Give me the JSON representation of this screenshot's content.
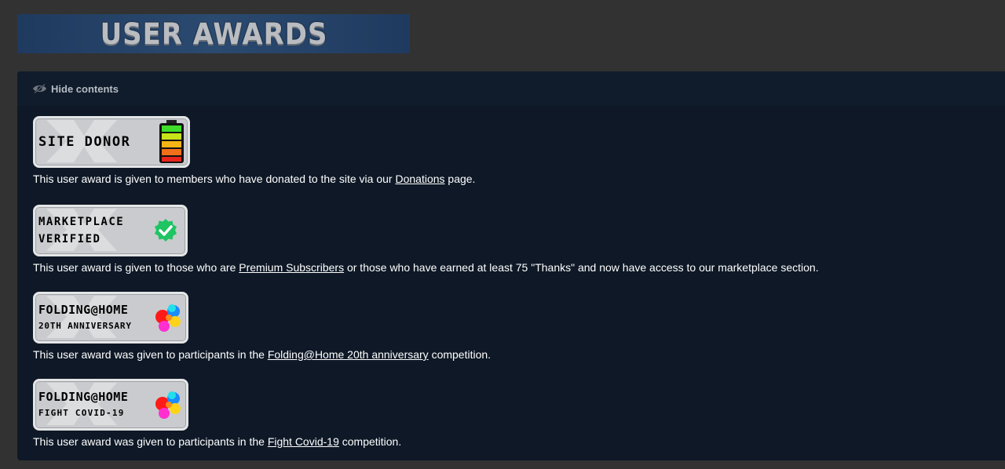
{
  "banner": {
    "title": "USER AWARDS"
  },
  "panel": {
    "toggle_label": "Hide contents"
  },
  "awards": [
    {
      "badge_line1": "SITE DONOR",
      "desc_before": "This user award is given to members who have donated to the site via our ",
      "link": "Donations",
      "desc_after": " page.",
      "icon": "battery-icon"
    },
    {
      "badge_line1": "MARKETPLACE",
      "badge_line2": "VERIFIED",
      "desc_before": "This user award is given to those who are ",
      "link": "Premium Subscribers",
      "desc_after": " or those who have earned at least 75 \"Thanks\" and now have access to our marketplace section.",
      "icon": "verified-check-icon"
    },
    {
      "badge_line1": "FOLDING@HOME",
      "badge_line2": "20TH ANNIVERSARY",
      "desc_before": "This user award was given to participants in the ",
      "link": "Folding@Home 20th anniversary",
      "desc_after": " competition.",
      "icon": "folding-molecule-icon"
    },
    {
      "badge_line1": "FOLDING@HOME",
      "badge_line2": "FIGHT COVID-19",
      "desc_before": "This user award was given to participants in the ",
      "link": "Fight Covid-19",
      "desc_after": " competition.",
      "icon": "folding-molecule-icon"
    }
  ]
}
